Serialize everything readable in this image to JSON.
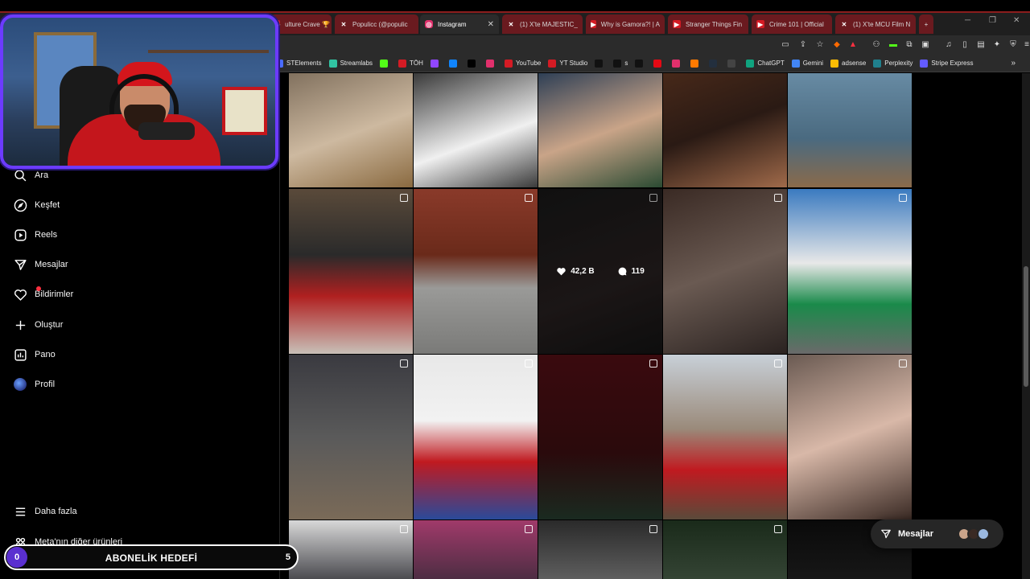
{
  "browser": {
    "tabs": [
      {
        "label": "ulture Crave 🏆 | C",
        "icon": "youtube-icon",
        "color": "#d41b24",
        "style": "red"
      },
      {
        "label": "Populicc (@populic",
        "icon": "x-icon",
        "color": "#000000",
        "style": "red"
      },
      {
        "label": "Instagram",
        "icon": "instagram-icon",
        "color": "#e1306c",
        "style": "active"
      },
      {
        "label": "(1) X'te MAJESTIC_",
        "icon": "x-icon",
        "color": "#000000",
        "style": "red"
      },
      {
        "label": "Why is Gamora?! | A",
        "icon": "youtube-icon",
        "color": "#d41b24",
        "style": "red"
      },
      {
        "label": "Stranger Things Fin",
        "icon": "youtube-icon",
        "color": "#d41b24",
        "style": "red"
      },
      {
        "label": "Crime 101 | Official",
        "icon": "youtube-icon",
        "color": "#d41b24",
        "style": "red"
      },
      {
        "label": "(1) X'te MCU Film N",
        "icon": "x-icon",
        "color": "#000000",
        "style": "red"
      }
    ],
    "new_tab": "+",
    "bookmarks": [
      {
        "label": "STElements",
        "icon": "st-icon",
        "color": "#4a6cff"
      },
      {
        "label": "Streamlabs",
        "icon": "streamlabs-icon",
        "color": "#31c3a2"
      },
      {
        "label": "",
        "icon": "kick-icon",
        "color": "#53fc18"
      },
      {
        "label": "TÖH",
        "icon": "toh-icon",
        "color": "#d41b24"
      },
      {
        "label": "",
        "icon": "twitch-icon",
        "color": "#9146ff"
      },
      {
        "label": "",
        "icon": "bluesky-icon",
        "color": "#1185fe"
      },
      {
        "label": "",
        "icon": "x-icon",
        "color": "#000000"
      },
      {
        "label": "",
        "icon": "instagram-icon",
        "color": "#e1306c"
      },
      {
        "label": "YouTube",
        "icon": "youtube-icon",
        "color": "#d41b24"
      },
      {
        "label": "YT Studio",
        "icon": "yt-studio-icon",
        "color": "#d41b24"
      },
      {
        "label": "",
        "icon": "tiktok-icon",
        "color": "#111111"
      },
      {
        "label": "s",
        "icon": "tiktok-shop-icon",
        "color": "#111111"
      },
      {
        "label": "",
        "icon": "threads-icon",
        "color": "#111111"
      },
      {
        "label": "",
        "icon": "netflix-icon",
        "color": "#e50914"
      },
      {
        "label": "",
        "icon": "puzzle-icon",
        "color": "#e1306c"
      },
      {
        "label": "",
        "icon": "box-icon",
        "color": "#ff7a00"
      },
      {
        "label": "",
        "icon": "amazon-icon",
        "color": "#232f3e"
      },
      {
        "label": "",
        "icon": "stack-icon",
        "color": "#444444"
      },
      {
        "label": "ChatGPT",
        "icon": "chatgpt-icon",
        "color": "#10a37f"
      },
      {
        "label": "Gemini",
        "icon": "gemini-icon",
        "color": "#4285f4"
      },
      {
        "label": "adsense",
        "icon": "adsense-icon",
        "color": "#fbbc04"
      },
      {
        "label": "Perplexity",
        "icon": "perplexity-icon",
        "color": "#20808d"
      },
      {
        "label": "Stripe Express",
        "icon": "stripe-icon",
        "color": "#635bff"
      }
    ],
    "bookmarks_more": "»"
  },
  "nav": {
    "items": [
      {
        "label": "Ara",
        "icon": "search-icon"
      },
      {
        "label": "Keşfet",
        "icon": "compass-icon"
      },
      {
        "label": "Reels",
        "icon": "reels-icon"
      },
      {
        "label": "Mesajlar",
        "icon": "send-icon"
      },
      {
        "label": "Bildirimler",
        "icon": "heart-icon"
      },
      {
        "label": "Oluştur",
        "icon": "plus-icon"
      },
      {
        "label": "Pano",
        "icon": "dashboard-icon"
      },
      {
        "label": "Profil",
        "icon": "avatar-icon"
      }
    ],
    "more": "Daha fazla",
    "meta": "Meta'nın diğer ürünleri"
  },
  "grid": {
    "hover_likes": "42,2 B",
    "hover_comments": "119"
  },
  "messages_pill": {
    "label": "Mesajlar"
  },
  "subscription_goal": {
    "count": "0",
    "label": "ABONELİK HEDEFİ",
    "goal": "5"
  },
  "colors": {
    "accent_purple": "#6c3bff",
    "instagram_notification": "#ff3040",
    "tab_red": "#6a1a1f"
  }
}
